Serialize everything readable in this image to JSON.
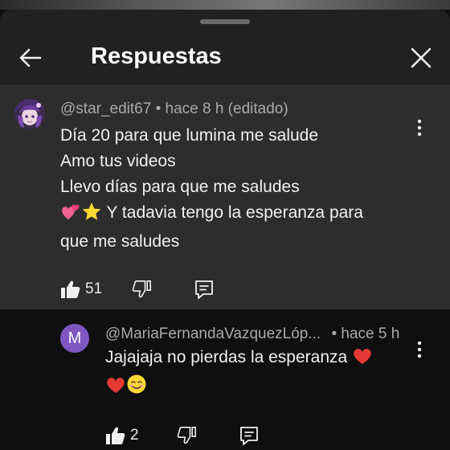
{
  "header": {
    "title": "Respuestas"
  },
  "comment": {
    "author": "@star_edit67",
    "meta": "• hace 8 h (editado)",
    "lines": [
      "Día 20 para que lumina me salude",
      "Amo tus videos",
      "Llevo días para que me saludes",
      "Y tadavia tengo la esperanza  para",
      "que me saludes"
    ],
    "like_count": "51"
  },
  "reply": {
    "avatar_letter": "M",
    "author": "@MariaFernandaVazquezLóp...",
    "meta": "• hace 5 h",
    "lines": [
      "Jajajaja no pierdas la esperanza",
      ""
    ],
    "like_count": "2"
  },
  "colors": {
    "sheet_bg": "#212121",
    "highlight_bg": "#2d2d2d",
    "avatar_reply": "#7e57c2",
    "heart": "#e53935"
  },
  "icons": [
    "back-arrow-icon",
    "close-icon",
    "more-vert-icon",
    "thumbs-up-icon",
    "thumbs-down-icon",
    "reply-icon",
    "two-hearts-emoji",
    "star-emoji",
    "red-heart-emoji",
    "smiling-face-emoji"
  ]
}
